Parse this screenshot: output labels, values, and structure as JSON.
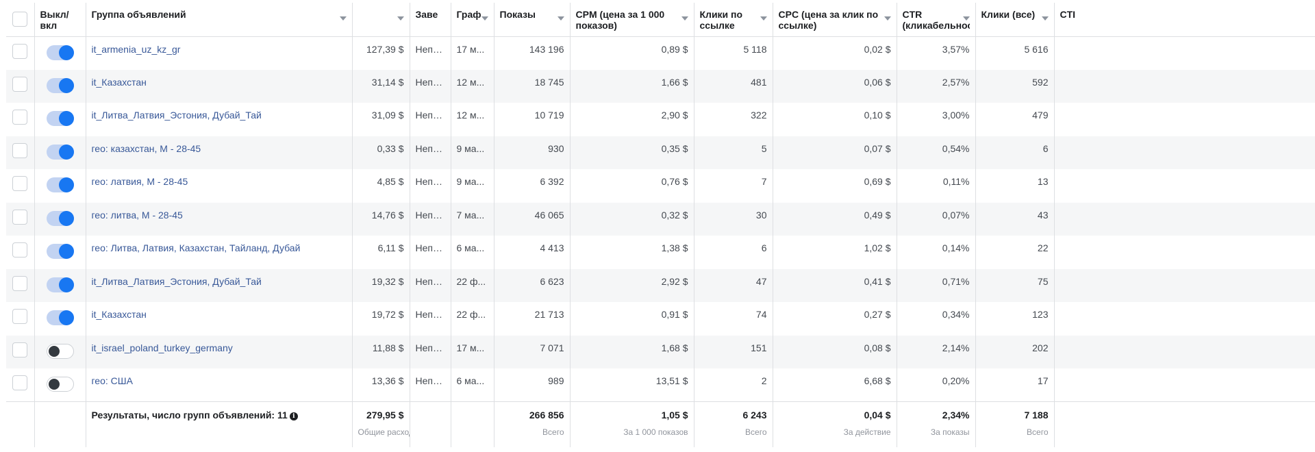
{
  "columns": [
    {
      "key": "select",
      "label": ""
    },
    {
      "key": "toggle",
      "label": "Выкл/\nвкл"
    },
    {
      "key": "name",
      "label": "Группа объявлений"
    },
    {
      "key": "spend",
      "label": ""
    },
    {
      "key": "delivery",
      "label": "Заве"
    },
    {
      "key": "schedule",
      "label": "Граф"
    },
    {
      "key": "impressions",
      "label": "Показы"
    },
    {
      "key": "cpm",
      "label": "CPM (цена за 1 000 показов)"
    },
    {
      "key": "link_clicks",
      "label": "Клики по ссылке"
    },
    {
      "key": "cpc",
      "label": "CPC (цена за клик по ссылке)"
    },
    {
      "key": "ctr",
      "label": "CTR (кликабельнос"
    },
    {
      "key": "clicks_all",
      "label": "Клики (все)"
    },
    {
      "key": "ctr_all",
      "label": "CTI"
    }
  ],
  "rows": [
    {
      "on": true,
      "name": "it_armenia_uz_kz_gr",
      "spend": "127,39 $",
      "delivery": "Непр...",
      "schedule": "17 м...",
      "impressions": "143 196",
      "cpm": "0,89 $",
      "link_clicks": "5 118",
      "cpc": "0,02 $",
      "ctr": "3,57%",
      "clicks_all": "5 616"
    },
    {
      "on": true,
      "name": "it_Казахстан",
      "spend": "31,14 $",
      "delivery": "Непр...",
      "schedule": "12 м...",
      "impressions": "18 745",
      "cpm": "1,66 $",
      "link_clicks": "481",
      "cpc": "0,06 $",
      "ctr": "2,57%",
      "clicks_all": "592"
    },
    {
      "on": true,
      "name": "it_Литва_Латвия_Эстония, Дубай_Тай",
      "spend": "31,09 $",
      "delivery": "Непр...",
      "schedule": "12 м...",
      "impressions": "10 719",
      "cpm": "2,90 $",
      "link_clicks": "322",
      "cpc": "0,10 $",
      "ctr": "3,00%",
      "clicks_all": "479"
    },
    {
      "on": true,
      "name": "гео: казахстан, М - 28-45",
      "spend": "0,33 $",
      "delivery": "Непр...",
      "schedule": "9 ма...",
      "impressions": "930",
      "cpm": "0,35 $",
      "link_clicks": "5",
      "cpc": "0,07 $",
      "ctr": "0,54%",
      "clicks_all": "6"
    },
    {
      "on": true,
      "name": "гео: латвия, М - 28-45",
      "spend": "4,85 $",
      "delivery": "Непр...",
      "schedule": "9 ма...",
      "impressions": "6 392",
      "cpm": "0,76 $",
      "link_clicks": "7",
      "cpc": "0,69 $",
      "ctr": "0,11%",
      "clicks_all": "13"
    },
    {
      "on": true,
      "name": "гео: литва, М - 28-45",
      "spend": "14,76 $",
      "delivery": "Непр...",
      "schedule": "7 ма...",
      "impressions": "46 065",
      "cpm": "0,32 $",
      "link_clicks": "30",
      "cpc": "0,49 $",
      "ctr": "0,07%",
      "clicks_all": "43"
    },
    {
      "on": true,
      "name": "гео: Литва, Латвия, Казахстан, Тайланд, Дубай",
      "spend": "6,11 $",
      "delivery": "Непр...",
      "schedule": "6 ма...",
      "impressions": "4 413",
      "cpm": "1,38 $",
      "link_clicks": "6",
      "cpc": "1,02 $",
      "ctr": "0,14%",
      "clicks_all": "22"
    },
    {
      "on": true,
      "name": "it_Литва_Латвия_Эстония, Дубай_Тай",
      "spend": "19,32 $",
      "delivery": "Непр...",
      "schedule": "22 ф...",
      "impressions": "6 623",
      "cpm": "2,92 $",
      "link_clicks": "47",
      "cpc": "0,41 $",
      "ctr": "0,71%",
      "clicks_all": "75"
    },
    {
      "on": true,
      "name": "it_Казахстан",
      "spend": "19,72 $",
      "delivery": "Непр...",
      "schedule": "22 ф...",
      "impressions": "21 713",
      "cpm": "0,91 $",
      "link_clicks": "74",
      "cpc": "0,27 $",
      "ctr": "0,34%",
      "clicks_all": "123"
    },
    {
      "on": false,
      "name": "it_israel_poland_turkey_germany",
      "spend": "11,88 $",
      "delivery": "Непр...",
      "schedule": "17 м...",
      "impressions": "7 071",
      "cpm": "1,68 $",
      "link_clicks": "151",
      "cpc": "0,08 $",
      "ctr": "2,14%",
      "clicks_all": "202"
    },
    {
      "on": false,
      "name": "гео: США",
      "spend": "13,36 $",
      "delivery": "Непр...",
      "schedule": "6 ма...",
      "impressions": "989",
      "cpm": "13,51 $",
      "link_clicks": "2",
      "cpc": "6,68 $",
      "ctr": "0,20%",
      "clicks_all": "17"
    }
  ],
  "summary": {
    "label": "Результаты, число групп объявлений: 11",
    "info_icon": "info-icon",
    "spend": {
      "value": "279,95 $",
      "caption": "Общие расходы"
    },
    "impressions": {
      "value": "266 856",
      "caption": "Всего"
    },
    "cpm": {
      "value": "1,05 $",
      "caption": "За 1 000 показов"
    },
    "link_clicks": {
      "value": "6 243",
      "caption": "Всего"
    },
    "cpc": {
      "value": "0,04 $",
      "caption": "За действие"
    },
    "ctr": {
      "value": "2,34%",
      "caption": "За показы"
    },
    "clicks_all": {
      "value": "7 188",
      "caption": "Всего"
    }
  },
  "colors": {
    "link": "#385898",
    "toggle_on": "#1877f2",
    "toggle_off_knob": "#343a40",
    "row_alt_bg": "#f5f6f7",
    "border": "#dddfe2"
  }
}
